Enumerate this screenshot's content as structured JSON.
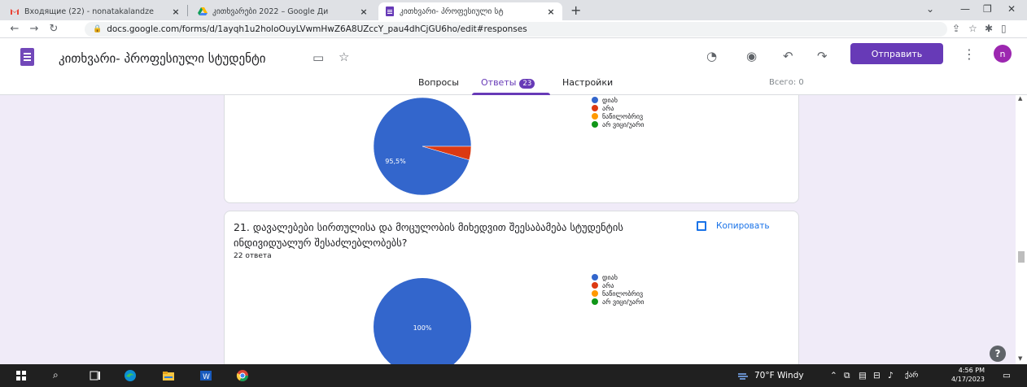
{
  "browser": {
    "tabs": [
      {
        "title": "Входящие (22) - nonatakalandze",
        "icon": "gmail-icon"
      },
      {
        "title": "კითხვარები 2022 – Google Ди",
        "icon": "google-drive-icon"
      },
      {
        "title": "კითხვარი- პროფესიული სტ",
        "icon": "google-forms-icon",
        "active": true
      }
    ],
    "new_tab": "+",
    "url": "docs.google.com/forms/d/1ayqh1u2holoOuyLVwmHwZ6A8UZccY_pau4dhCjGU6ho/edit#responses"
  },
  "form": {
    "title": "კითხვარი- პროფესიული სტუდენტი",
    "send_label": "Отправить",
    "avatar_letter": "n",
    "tabs": {
      "questions": "Вопросы",
      "answers": "Ответы",
      "answers_count": "23",
      "settings": "Настройки"
    },
    "total": "Всего: 0"
  },
  "legend_labels": {
    "yes": "დიახ",
    "no": "არა",
    "partial": "ნაწილობრივ",
    "unknown": "არ ვიცი/უარი"
  },
  "question_21": {
    "title": "21. დავალებები სირთულისა და მოცულობის მიხედვით შეესაბამება სტუდენტის ინდივიდუალურ შესაძლებლობებს?",
    "count": "22 ответа",
    "copy_label": "Копировать"
  },
  "chart_data": [
    {
      "type": "pie",
      "categories": [
        "დიახ",
        "არა",
        "ნაწილობრივ",
        "არ ვიცი/უარი"
      ],
      "values": [
        95.5,
        4.5,
        0,
        0
      ],
      "labels": [
        "95,5%"
      ],
      "colors": [
        "#3366cc",
        "#dc3912",
        "#ff9900",
        "#109618"
      ]
    },
    {
      "type": "pie",
      "categories": [
        "დიახ",
        "არა",
        "ნაწილობრივ",
        "არ ვიცი/უარი"
      ],
      "values": [
        100,
        0,
        0,
        0
      ],
      "labels": [
        "100%"
      ],
      "colors": [
        "#3366cc",
        "#dc3912",
        "#ff9900",
        "#109618"
      ]
    }
  ],
  "taskbar": {
    "weather": "70°F Windy",
    "lang": "ქარ",
    "time": "4:56 PM",
    "date": "4/17/2023"
  }
}
